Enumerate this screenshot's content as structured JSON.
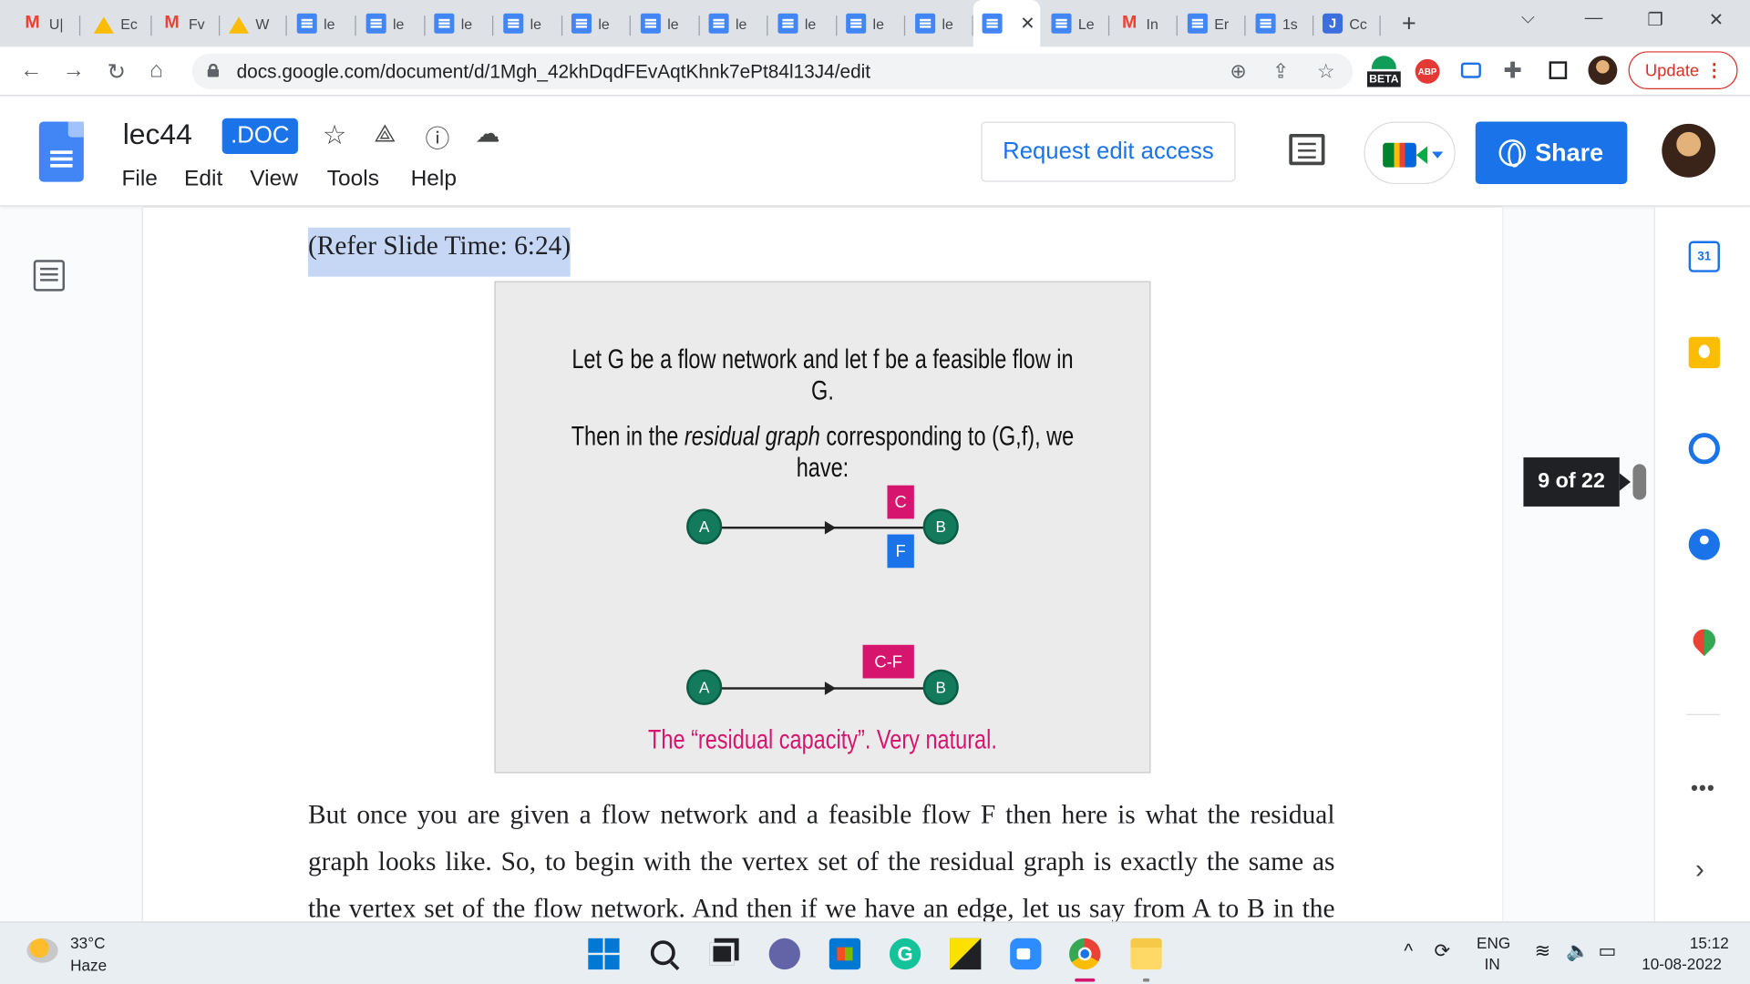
{
  "browser": {
    "tabs": [
      {
        "label": "U|",
        "icon": "gmail-icon"
      },
      {
        "label": "Ec",
        "icon": "drive-icon"
      },
      {
        "label": "Fv",
        "icon": "gmail-icon"
      },
      {
        "label": "W",
        "icon": "drive-icon"
      },
      {
        "label": "le",
        "icon": "docs-icon"
      },
      {
        "label": "le",
        "icon": "docs-icon"
      },
      {
        "label": "le",
        "icon": "docs-icon"
      },
      {
        "label": "le",
        "icon": "docs-icon"
      },
      {
        "label": "le",
        "icon": "docs-icon"
      },
      {
        "label": "le",
        "icon": "docs-icon"
      },
      {
        "label": "le",
        "icon": "docs-icon"
      },
      {
        "label": "le",
        "icon": "docs-icon"
      },
      {
        "label": "le",
        "icon": "docs-icon"
      },
      {
        "label": "le",
        "icon": "docs-icon"
      },
      {
        "label": "",
        "icon": "docs-icon",
        "active": true
      },
      {
        "label": "Le",
        "icon": "docs-icon"
      },
      {
        "label": "In",
        "icon": "gmail-icon"
      },
      {
        "label": "Er",
        "icon": "docs-icon"
      },
      {
        "label": "1s",
        "icon": "docs-icon"
      },
      {
        "label": "Cc",
        "icon": "j-icon"
      }
    ],
    "close_glyph": "✕",
    "new_tab_glyph": "+",
    "url": "docs.google.com/document/d/1Mgh_42khDqdFEvAqtKhnk7ePt84l13J4/edit",
    "update_label": "Update",
    "beta_label": "BETA",
    "abp_label": "ABP"
  },
  "docs": {
    "title": "lec44",
    "format_badge": ".DOC",
    "menu": [
      "File",
      "Edit",
      "View",
      "Tools",
      "Help"
    ],
    "request_edit_label": "Request edit access",
    "share_label": "Share"
  },
  "document": {
    "refer_text": "(Refer Slide Time: 6:24)",
    "slide": {
      "line1": "Let G be a flow network and let f be a feasible flow in G.",
      "line2_pre": "Then in the ",
      "line2_em": "residual graph",
      "line2_post": " corresponding to (G,f), we have:",
      "node_a": "A",
      "node_b": "B",
      "label_c": "C",
      "label_f": "F",
      "label_cf": "C-F",
      "caption": "The “residual capacity”. Very natural."
    },
    "body_lines": [
      "But once you are given a flow network and a feasible flow F then here is what the residual",
      "graph looks like. So, to begin with the vertex set of the residual graph is exactly the same as",
      "the vertex set of the flow network. And then if we have an edge, let us say from A to B in the"
    ],
    "page_counter": "9 of 22"
  },
  "side_panel": {
    "calendar_day": "31",
    "more_glyph": "•••",
    "expand_glyph": "›"
  },
  "taskbar": {
    "temperature": "33°C",
    "weather": "Haze",
    "lang_line1": "ENG",
    "lang_line2": "IN",
    "time": "15:12",
    "date": "10-08-2022",
    "grammarly_glyph": "G"
  },
  "colors": {
    "accent": "#1a73e8",
    "node_green": "#137b5b",
    "capacity_pink": "#d6156f",
    "flow_blue": "#1a73e8",
    "update_red": "#d93025"
  }
}
